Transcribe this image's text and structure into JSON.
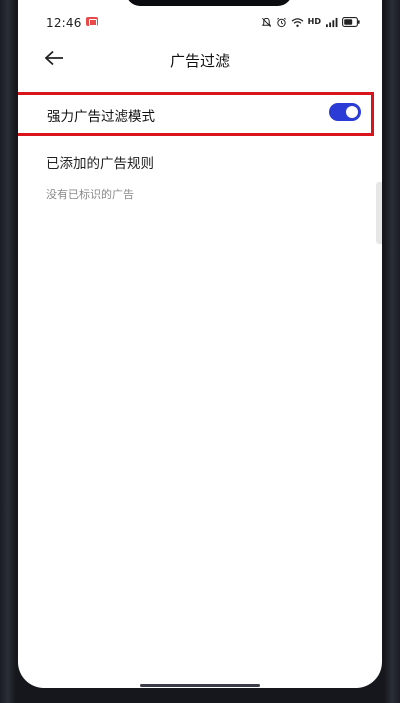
{
  "status_bar": {
    "time": "12:46",
    "network_label": "HD",
    "icons": [
      "screen-record-icon",
      "mute-icon",
      "alarm-icon",
      "wifi-icon",
      "signal-icon",
      "battery-icon"
    ]
  },
  "header": {
    "back_icon": "back-arrow-icon",
    "title": "广告过滤"
  },
  "settings": {
    "strong_filter_label": "强力广告过滤模式",
    "strong_filter_enabled": true
  },
  "rules": {
    "section_title": "已添加的广告规则",
    "empty_text": "没有已标识的广告"
  },
  "colors": {
    "accent": "#2a3bd6",
    "highlight_border": "#d9141b",
    "record_badge": "#e84a4a"
  }
}
